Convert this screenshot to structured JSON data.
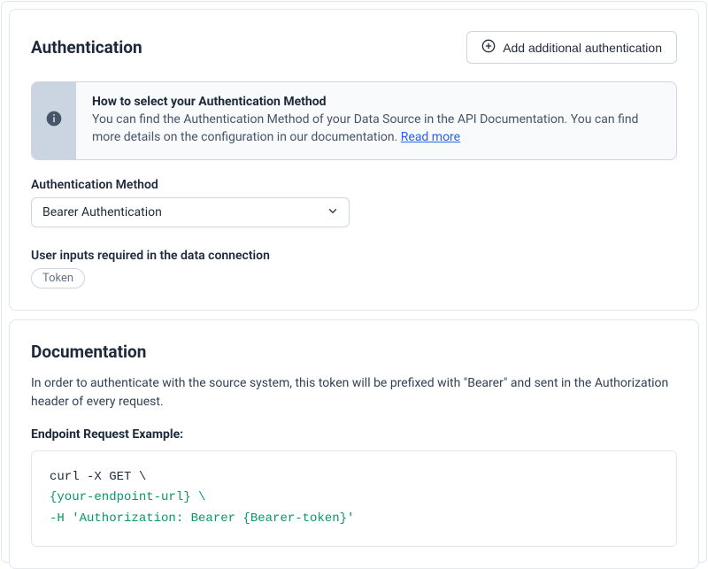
{
  "auth": {
    "title": "Authentication",
    "add_button": "Add additional authentication",
    "callout": {
      "title": "How to select your Authentication Method",
      "desc": "You can find the Authentication Method of your Data Source in the API Documentation. You can find more details on the configuration in our documentation. ",
      "read_more": "Read more"
    },
    "method_label": "Authentication Method",
    "method_value": "Bearer Authentication",
    "inputs_label": "User inputs required in the data connection",
    "inputs_chip": "Token"
  },
  "docs": {
    "title": "Documentation",
    "desc": "In order to authenticate with the source system, this token will be prefixed with \"Bearer\" and sent in the Authorization header of every request.",
    "example_label": "Endpoint Request Example:",
    "code_line1": "curl -X GET \\",
    "code_line2": "{your-endpoint-url} \\",
    "code_line3": "-H 'Authorization: Bearer {Bearer-token}'"
  }
}
